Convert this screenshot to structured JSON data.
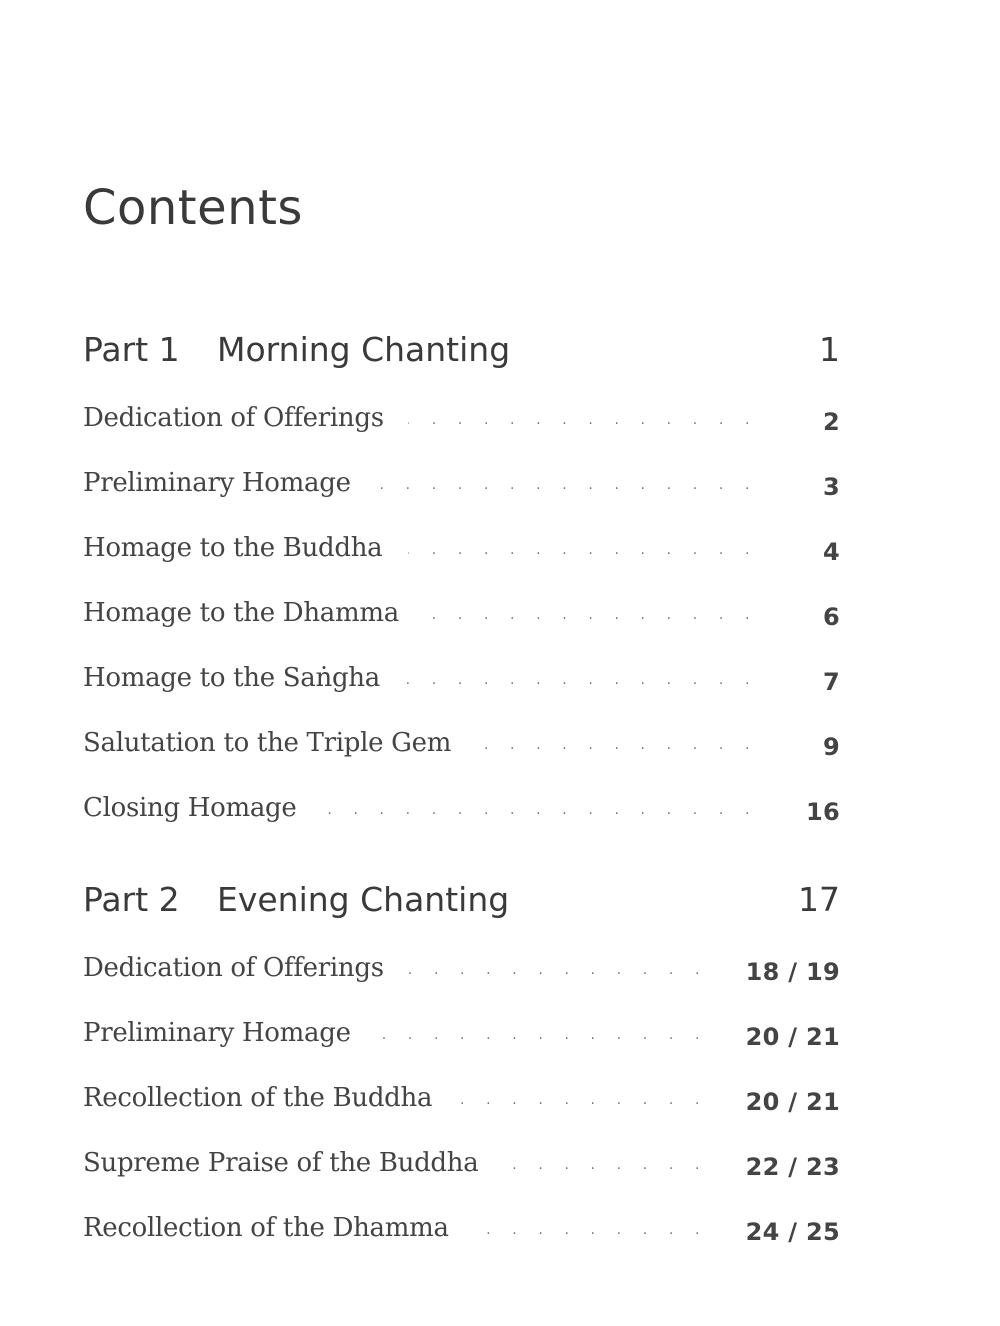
{
  "title": "Contents",
  "parts": [
    {
      "number": "Part 1",
      "name": "Morning Chanting",
      "page": "1",
      "entries": [
        {
          "title": "Dedication of Offerings",
          "page": "2"
        },
        {
          "title": "Preliminary Homage",
          "page": "3"
        },
        {
          "title": "Homage to the Buddha",
          "page": "4"
        },
        {
          "title": "Homage to the Dhamma",
          "page": "6"
        },
        {
          "title": "Homage to the Saṅgha",
          "page": "7"
        },
        {
          "title": "Salutation to the Triple Gem",
          "page": "9"
        },
        {
          "title": "Closing Homage",
          "page": "16"
        }
      ]
    },
    {
      "number": "Part 2",
      "name": "Evening Chanting",
      "page": "17",
      "entries": [
        {
          "title": "Dedication of Offerings",
          "page": "18 / 19"
        },
        {
          "title": "Preliminary Homage",
          "page": "20 / 21"
        },
        {
          "title": "Recollection of the Buddha",
          "page": "20 / 21"
        },
        {
          "title": "Supreme Praise of the Buddha",
          "page": "22 / 23"
        },
        {
          "title": "Recollection of the Dhamma",
          "page": "24 / 25"
        }
      ]
    }
  ]
}
